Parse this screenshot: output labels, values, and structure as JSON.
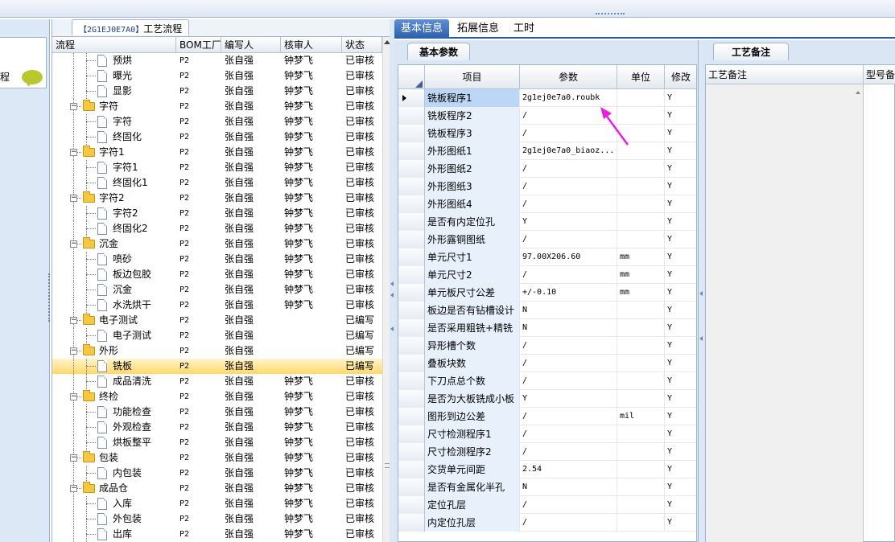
{
  "flow_panel": {
    "tab_code": "【2G1EJ0E7A0】",
    "tab_title": "工艺流程",
    "left_strip_label": "程",
    "columns": [
      "流程",
      "BOM工厂",
      "编写人",
      "核审人",
      "状态"
    ],
    "rows": [
      {
        "level": 2,
        "type": "doc",
        "name": "预烘",
        "bom": "P2",
        "writer": "张自强",
        "reviewer": "钟梦飞",
        "status": "已审核"
      },
      {
        "level": 2,
        "type": "doc",
        "name": "曝光",
        "bom": "P2",
        "writer": "张自强",
        "reviewer": "钟梦飞",
        "status": "已审核"
      },
      {
        "level": 2,
        "type": "doc",
        "name": "显影",
        "bom": "P2",
        "writer": "张自强",
        "reviewer": "钟梦飞",
        "status": "已审核"
      },
      {
        "level": 1,
        "type": "folder",
        "name": "字符",
        "bom": "P2",
        "writer": "张自强",
        "reviewer": "钟梦飞",
        "status": "已审核"
      },
      {
        "level": 2,
        "type": "doc",
        "name": "字符",
        "bom": "P2",
        "writer": "张自强",
        "reviewer": "钟梦飞",
        "status": "已审核"
      },
      {
        "level": 2,
        "type": "doc",
        "name": "终固化",
        "bom": "P2",
        "writer": "张自强",
        "reviewer": "钟梦飞",
        "status": "已审核"
      },
      {
        "level": 1,
        "type": "folder",
        "name": "字符1",
        "bom": "P2",
        "writer": "张自强",
        "reviewer": "钟梦飞",
        "status": "已审核"
      },
      {
        "level": 2,
        "type": "doc",
        "name": "字符1",
        "bom": "P2",
        "writer": "张自强",
        "reviewer": "钟梦飞",
        "status": "已审核"
      },
      {
        "level": 2,
        "type": "doc",
        "name": "终固化1",
        "bom": "P2",
        "writer": "张自强",
        "reviewer": "钟梦飞",
        "status": "已审核"
      },
      {
        "level": 1,
        "type": "folder",
        "name": "字符2",
        "bom": "P2",
        "writer": "张自强",
        "reviewer": "钟梦飞",
        "status": "已审核"
      },
      {
        "level": 2,
        "type": "doc",
        "name": "字符2",
        "bom": "P2",
        "writer": "张自强",
        "reviewer": "钟梦飞",
        "status": "已审核"
      },
      {
        "level": 2,
        "type": "doc",
        "name": "终固化2",
        "bom": "P2",
        "writer": "张自强",
        "reviewer": "钟梦飞",
        "status": "已审核"
      },
      {
        "level": 1,
        "type": "folder",
        "name": "沉金",
        "bom": "P2",
        "writer": "张自强",
        "reviewer": "钟梦飞",
        "status": "已审核"
      },
      {
        "level": 2,
        "type": "doc",
        "name": "喷砂",
        "bom": "P2",
        "writer": "张自强",
        "reviewer": "钟梦飞",
        "status": "已审核"
      },
      {
        "level": 2,
        "type": "doc",
        "name": "板边包胶",
        "bom": "P2",
        "writer": "张自强",
        "reviewer": "钟梦飞",
        "status": "已审核"
      },
      {
        "level": 2,
        "type": "doc",
        "name": "沉金",
        "bom": "P2",
        "writer": "张自强",
        "reviewer": "钟梦飞",
        "status": "已审核"
      },
      {
        "level": 2,
        "type": "doc",
        "name": "水洗烘干",
        "bom": "P2",
        "writer": "张自强",
        "reviewer": "钟梦飞",
        "status": "已审核"
      },
      {
        "level": 1,
        "type": "folder",
        "name": "电子测试",
        "bom": "P2",
        "writer": "张自强",
        "reviewer": "",
        "status": "已编写"
      },
      {
        "level": 2,
        "type": "doc",
        "name": "电子测试",
        "bom": "P2",
        "writer": "张自强",
        "reviewer": "",
        "status": "已编写"
      },
      {
        "level": 1,
        "type": "folder",
        "name": "外形",
        "bom": "P2",
        "writer": "张自强",
        "reviewer": "",
        "status": "已编写"
      },
      {
        "level": 2,
        "type": "doc",
        "name": "铣板",
        "bom": "P2",
        "writer": "张自强",
        "reviewer": "",
        "status": "已编写",
        "selected": true
      },
      {
        "level": 2,
        "type": "doc",
        "name": "成品清洗",
        "bom": "P2",
        "writer": "张自强",
        "reviewer": "钟梦飞",
        "status": "已审核"
      },
      {
        "level": 1,
        "type": "folder",
        "name": "终检",
        "bom": "P2",
        "writer": "张自强",
        "reviewer": "钟梦飞",
        "status": "已审核"
      },
      {
        "level": 2,
        "type": "doc",
        "name": "功能检查",
        "bom": "P2",
        "writer": "张自强",
        "reviewer": "钟梦飞",
        "status": "已审核"
      },
      {
        "level": 2,
        "type": "doc",
        "name": "外观检查",
        "bom": "P2",
        "writer": "张自强",
        "reviewer": "钟梦飞",
        "status": "已审核"
      },
      {
        "level": 2,
        "type": "doc",
        "name": "烘板整平",
        "bom": "P2",
        "writer": "张自强",
        "reviewer": "钟梦飞",
        "status": "已审核"
      },
      {
        "level": 1,
        "type": "folder",
        "name": "包装",
        "bom": "P2",
        "writer": "张自强",
        "reviewer": "钟梦飞",
        "status": "已审核"
      },
      {
        "level": 2,
        "type": "doc",
        "name": "内包装",
        "bom": "P2",
        "writer": "张自强",
        "reviewer": "钟梦飞",
        "status": "已审核"
      },
      {
        "level": 1,
        "type": "folder",
        "name": "成品仓",
        "bom": "P2",
        "writer": "张自强",
        "reviewer": "钟梦飞",
        "status": "已审核"
      },
      {
        "level": 2,
        "type": "doc",
        "name": "入库",
        "bom": "P2",
        "writer": "张自强",
        "reviewer": "钟梦飞",
        "status": "已审核"
      },
      {
        "level": 2,
        "type": "doc",
        "name": "外包装",
        "bom": "P2",
        "writer": "张自强",
        "reviewer": "钟梦飞",
        "status": "已审核"
      },
      {
        "level": 2,
        "type": "doc",
        "name": "出库",
        "bom": "P2",
        "writer": "张自强",
        "reviewer": "钟梦飞",
        "status": "已审核"
      }
    ]
  },
  "right_tabs": [
    "基本信息",
    "拓展信息",
    "工时"
  ],
  "basic_panel": {
    "tab_label": "基本参数",
    "columns": [
      "项目",
      "参数",
      "单位",
      "修改"
    ],
    "rows": [
      {
        "item": "铣板程序1",
        "param": "2g1ej0e7a0.roubk",
        "unit": "",
        "mod": "Y",
        "current": true
      },
      {
        "item": "铣板程序2",
        "param": "/",
        "unit": "",
        "mod": "Y"
      },
      {
        "item": "铣板程序3",
        "param": "/",
        "unit": "",
        "mod": "Y"
      },
      {
        "item": "外形图纸1",
        "param": "2g1ej0e7a0_biaoz...",
        "unit": "",
        "mod": "Y"
      },
      {
        "item": "外形图纸2",
        "param": "/",
        "unit": "",
        "mod": "Y"
      },
      {
        "item": "外形图纸3",
        "param": "/",
        "unit": "",
        "mod": "Y"
      },
      {
        "item": "外形图纸4",
        "param": "/",
        "unit": "",
        "mod": "Y"
      },
      {
        "item": "是否有内定位孔",
        "param": "Y",
        "unit": "",
        "mod": "Y"
      },
      {
        "item": "外形露铜图纸",
        "param": "/",
        "unit": "",
        "mod": "Y"
      },
      {
        "item": "单元尺寸1",
        "param": "97.00X206.60",
        "unit": "mm",
        "mod": "Y"
      },
      {
        "item": "单元尺寸2",
        "param": "/",
        "unit": "mm",
        "mod": "Y"
      },
      {
        "item": "单元板尺寸公差",
        "param": "+/-0.10",
        "unit": "mm",
        "mod": "Y"
      },
      {
        "item": "板边是否有钻槽设计",
        "param": "N",
        "unit": "",
        "mod": "Y"
      },
      {
        "item": "是否采用粗铣+精铣",
        "param": "N",
        "unit": "",
        "mod": "Y"
      },
      {
        "item": "异形槽个数",
        "param": "/",
        "unit": "",
        "mod": "Y"
      },
      {
        "item": "叠板块数",
        "param": "/",
        "unit": "",
        "mod": "Y"
      },
      {
        "item": "下刀点总个数",
        "param": "/",
        "unit": "",
        "mod": "Y"
      },
      {
        "item": "是否为大板铣成小板",
        "param": "Y",
        "unit": "",
        "mod": "Y"
      },
      {
        "item": "图形到边公差",
        "param": "/",
        "unit": "mil",
        "mod": "Y"
      },
      {
        "item": "尺寸检测程序1",
        "param": "/",
        "unit": "",
        "mod": "Y"
      },
      {
        "item": "尺寸检测程序2",
        "param": "/",
        "unit": "",
        "mod": "Y"
      },
      {
        "item": "交货单元间距",
        "param": "2.54",
        "unit": "",
        "mod": "Y"
      },
      {
        "item": "是否有金属化半孔",
        "param": "N",
        "unit": "",
        "mod": "Y"
      },
      {
        "item": "定位孔层",
        "param": "/",
        "unit": "",
        "mod": "Y"
      },
      {
        "item": "内定位孔层",
        "param": "/",
        "unit": "",
        "mod": "Y"
      }
    ]
  },
  "notes_panel": {
    "tab_label": "工艺备注",
    "columns": [
      "工艺备注",
      "型号备"
    ]
  },
  "colors": {
    "accent": "#2c5ea9",
    "annotation_arrow": "#e81ee0",
    "selection": "#ffd86b",
    "chat_icon": "#b9c92d"
  }
}
